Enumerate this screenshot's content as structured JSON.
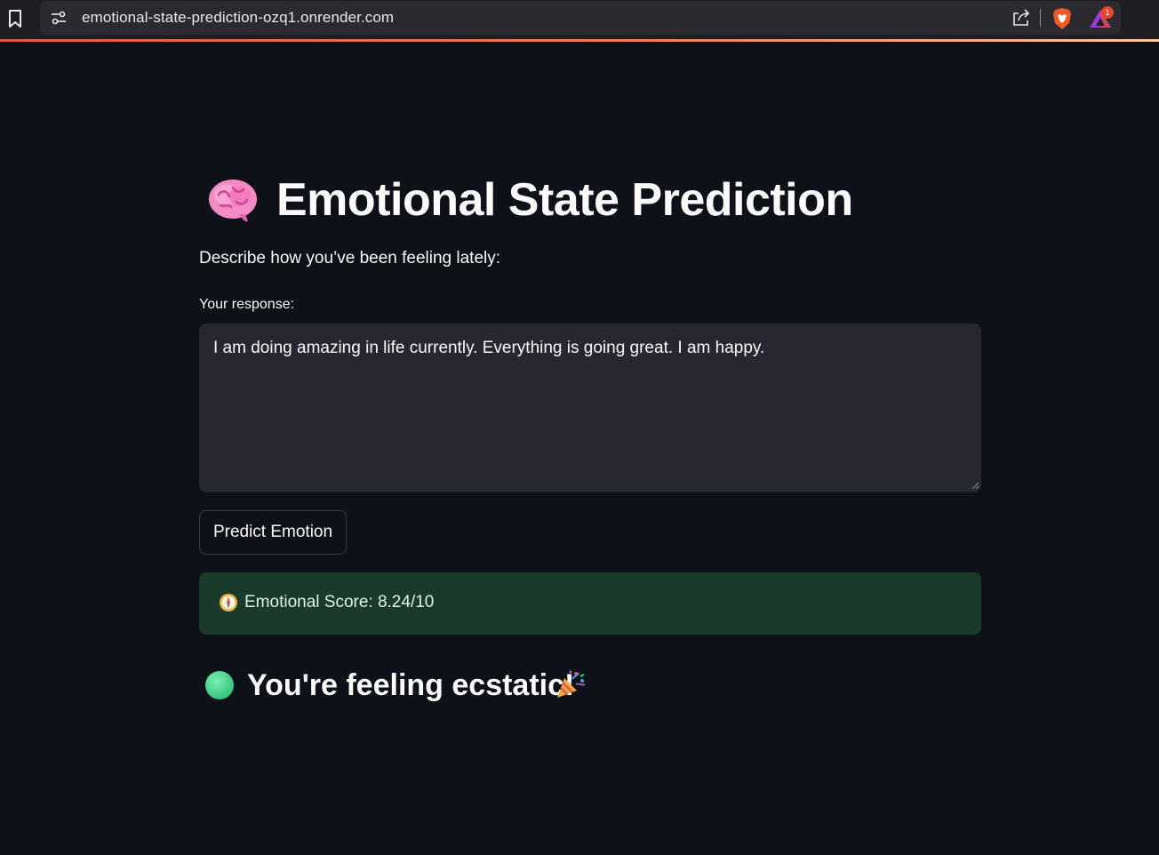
{
  "browser": {
    "url": "emotional-state-prediction-ozq1.onrender.com",
    "rewards_badge": "1",
    "icons": [
      "bookmark-icon",
      "site-info-icon",
      "share-icon",
      "brave-shield-icon",
      "brave-rewards-icon"
    ]
  },
  "app": {
    "title": "Emotional State Prediction",
    "title_icon": "brain-icon",
    "prompt": "Describe how you’ve been feeling lately:",
    "response_label": "Your response:",
    "response_value": "I am doing amazing in life currently. Everything is going great. I am happy.",
    "predict_button_label": "Predict Emotion",
    "score_icon": "compass-icon",
    "score_text": "Emotional Score: 8.24/10",
    "result_icon": "green-circle-icon",
    "result_text": "You're feeling ecstatic!",
    "result_emoji_icon": "party-popper-icon"
  },
  "colors": {
    "background": "#0e1117",
    "textarea_bg": "#262730",
    "score_bg": "#1a3a2a",
    "result_circle": "#3ecf8e"
  }
}
